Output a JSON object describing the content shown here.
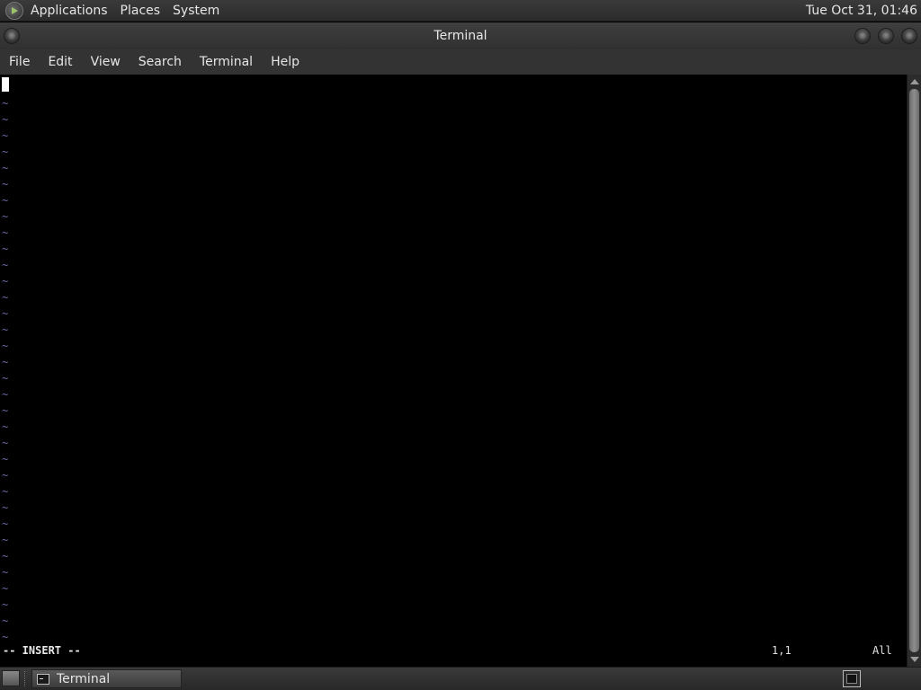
{
  "top_panel": {
    "menus": [
      "Applications",
      "Places",
      "System"
    ],
    "clock": "Tue Oct 31, 01:46"
  },
  "window": {
    "title": "Terminal",
    "menu": [
      "File",
      "Edit",
      "View",
      "Search",
      "Terminal",
      "Help"
    ]
  },
  "editor": {
    "empty_line_marker": "~",
    "empty_line_count": 34,
    "mode": "-- INSERT --",
    "cursor_position": "1,1",
    "scroll_position": "All"
  },
  "taskbar": {
    "tasks": [
      {
        "label": "Terminal"
      }
    ]
  },
  "colors": {
    "terminal_bg": "#000000",
    "tilde_color": "#6a6aa8",
    "panel_bg": "#333333"
  }
}
